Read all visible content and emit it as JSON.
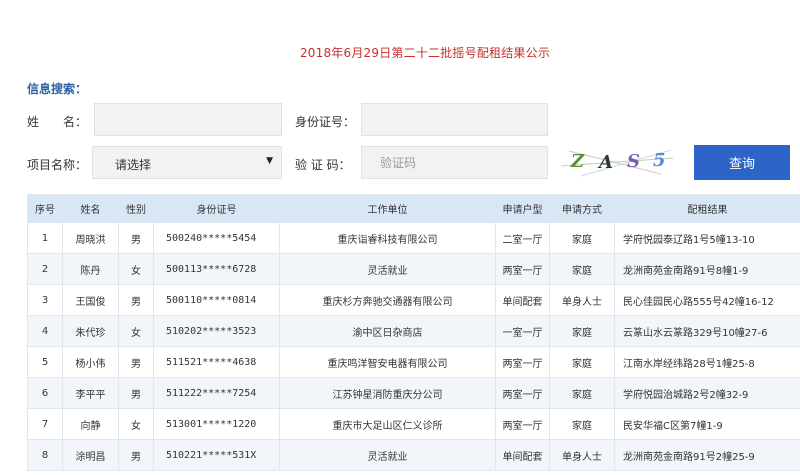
{
  "page": {
    "title": "2018年6月29日第二十二批摇号配租结果公示"
  },
  "search": {
    "heading": "信息搜索：",
    "name_label": "姓　　名：",
    "idcard_label": "身份证号：",
    "project_label": "项目名称：",
    "project_selected": "请选择",
    "captcha_label": "验 证 码：",
    "captcha_placeholder": "验证码",
    "captcha_chars": [
      "Z",
      "A",
      "S",
      "5"
    ],
    "query_button": "查询"
  },
  "table": {
    "headers": [
      "序号",
      "姓名",
      "性别",
      "身份证号",
      "工作单位",
      "申请户型",
      "申请方式",
      "配租结果"
    ],
    "rows": [
      [
        "1",
        "周晓洪",
        "男",
        "500240*****5454",
        "重庆诣睿科技有限公司",
        "二室一厅",
        "家庭",
        "学府悦园泰辽路1号5幢13-10"
      ],
      [
        "2",
        "陈丹",
        "女",
        "500113*****6728",
        "灵活就业",
        "两室一厅",
        "家庭",
        "龙洲南苑金南路91号8幢1-9"
      ],
      [
        "3",
        "王国俊",
        "男",
        "500110*****0814",
        "重庆杉方奔驰交通器有限公司",
        "单间配套",
        "单身人士",
        "民心佳园民心路555号42幢16-12"
      ],
      [
        "4",
        "朱代珍",
        "女",
        "510202*****3523",
        "渝中区日杂商店",
        "一室一厅",
        "家庭",
        "云篆山水云篆路329号10幢27-6"
      ],
      [
        "5",
        "杨小伟",
        "男",
        "511521*****4638",
        "重庆鸣洋智安电器有限公司",
        "两室一厅",
        "家庭",
        "江南水岸经纬路28号1幢25-8"
      ],
      [
        "6",
        "李平平",
        "男",
        "511222*****7254",
        "江苏钟星消防重庆分公司",
        "两室一厅",
        "家庭",
        "学府悦园治城路2号2幢32-9"
      ],
      [
        "7",
        "向静",
        "女",
        "513001*****1220",
        "重庆市大足山区仁义诊所",
        "两室一厅",
        "家庭",
        "民安华福C区第7幢1-9"
      ],
      [
        "8",
        "涂明昌",
        "男",
        "510221*****531X",
        "灵活就业",
        "单间配套",
        "单身人士",
        "龙洲南苑金南路91号2幢25-9"
      ]
    ]
  },
  "colors": {
    "title_red": "#c9302c",
    "heading_blue": "#2f62a8",
    "button_blue": "#2d64c8",
    "header_bg": "#d9e6f5",
    "alt_row_bg": "#f2f6fb"
  }
}
